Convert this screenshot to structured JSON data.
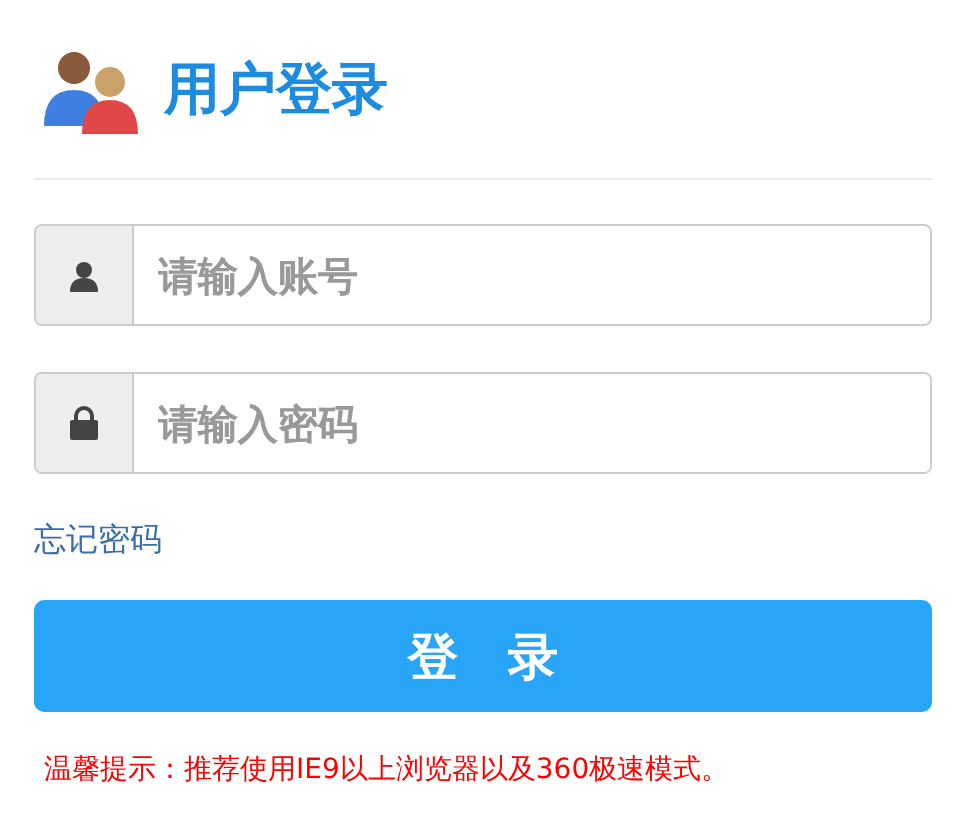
{
  "header": {
    "title": "用户登录"
  },
  "fields": [
    {
      "kind": "user",
      "placeholder": "请输入账号"
    },
    {
      "kind": "password",
      "placeholder": "请输入密码"
    }
  ],
  "forgot_link": "忘记密码",
  "login_button": "登　录",
  "notice": "温馨提示：推荐使用IE9以上浏览器以及360极速模式。"
}
